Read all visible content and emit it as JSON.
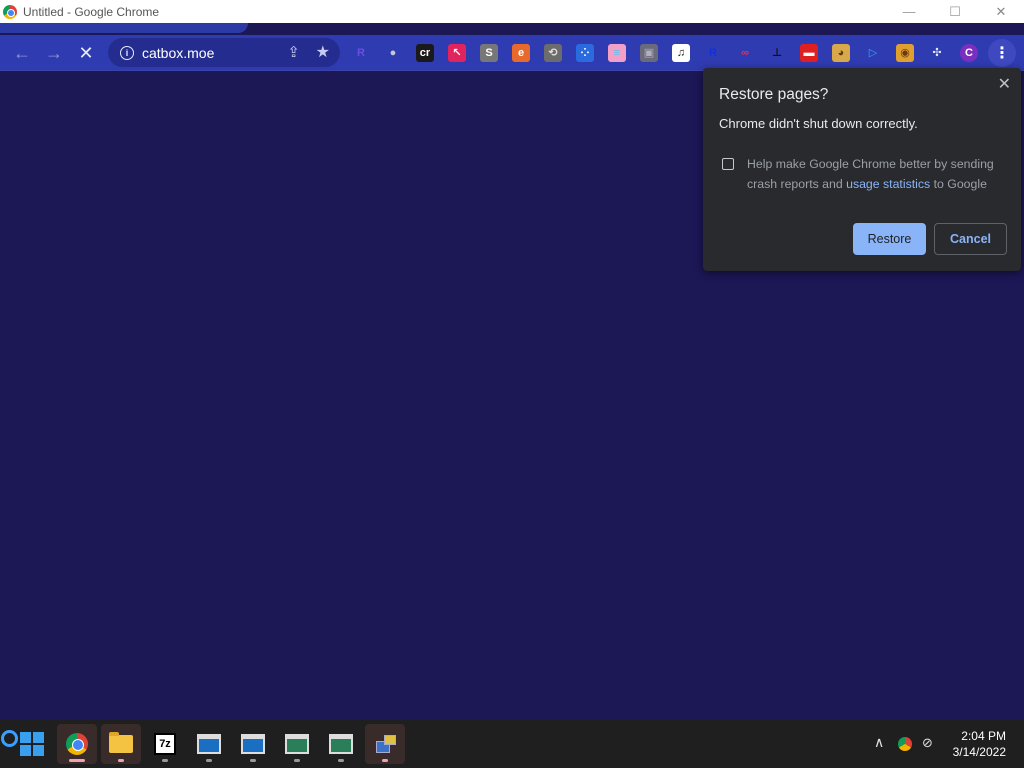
{
  "window": {
    "title": "Untitled - Google Chrome",
    "minimize": "—",
    "maximize": "☐",
    "close": "✕"
  },
  "toolbar": {
    "back_icon": "←",
    "forward_icon": "→",
    "stop_icon": "✕",
    "url": "catbox.moe",
    "share_icon": "⇪",
    "star_icon": "★",
    "menu_icon": "⋮"
  },
  "extensions": [
    {
      "name": "ext-r-icon",
      "glyph": "R",
      "bg": "transparent",
      "color": "#6b4fe0"
    },
    {
      "name": "ext-cloud-icon",
      "glyph": "●",
      "bg": "transparent",
      "color": "#c8c8d0"
    },
    {
      "name": "ext-cr-icon",
      "glyph": "cr",
      "bg": "#1a1a1a",
      "color": "#ffffff"
    },
    {
      "name": "ext-pointer-icon",
      "glyph": "↖",
      "bg": "#e0245e",
      "color": "#ffffff"
    },
    {
      "name": "ext-s-icon",
      "glyph": "S",
      "bg": "#777777",
      "color": "#ffffff"
    },
    {
      "name": "ext-edge-icon",
      "glyph": "e",
      "bg": "#e8692c",
      "color": "#ffffff"
    },
    {
      "name": "ext-sync-icon",
      "glyph": "⟲",
      "bg": "#6c6c6c",
      "color": "#e0e0e0"
    },
    {
      "name": "ext-grid-icon",
      "glyph": "⁘",
      "bg": "#2a6be0",
      "color": "#ffffff"
    },
    {
      "name": "ext-flag-icon",
      "glyph": "≡",
      "bg": "#f2a0c8",
      "color": "#5bc0f0"
    },
    {
      "name": "ext-image-icon",
      "glyph": "▣",
      "bg": "#6a6a7a",
      "color": "#b0b0c0"
    },
    {
      "name": "ext-clef-icon",
      "glyph": "♫",
      "bg": "#ffffff",
      "color": "#222222"
    },
    {
      "name": "ext-r-blue-icon",
      "glyph": "R",
      "bg": "transparent",
      "color": "#1030e0"
    },
    {
      "name": "ext-glasses-icon",
      "glyph": "∞",
      "bg": "transparent",
      "color": "#e03050"
    },
    {
      "name": "ext-stamp-icon",
      "glyph": "⊥",
      "bg": "transparent",
      "color": "#111111"
    },
    {
      "name": "ext-video-icon",
      "glyph": "▬",
      "bg": "#e02020",
      "color": "#ffffff"
    },
    {
      "name": "ext-doge-icon",
      "glyph": "◕",
      "bg": "#d9a84a",
      "color": "#5a3a10"
    },
    {
      "name": "ext-play-icon",
      "glyph": "▷",
      "bg": "transparent",
      "color": "#3aa0ff"
    },
    {
      "name": "ext-monkey-icon",
      "glyph": "◉",
      "bg": "#e0a030",
      "color": "#6a3a10"
    },
    {
      "name": "extensions-puzzle-icon",
      "glyph": "✣",
      "bg": "transparent",
      "color": "#e8eaff"
    },
    {
      "name": "profile-avatar-icon",
      "glyph": "C",
      "bg": "#7b2fbe",
      "color": "#ffffff"
    }
  ],
  "restore_bubble": {
    "title": "Restore pages?",
    "message": "Chrome didn't shut down correctly.",
    "consent_prefix": "Help make Google Chrome better by sending crash reports and ",
    "consent_link": "usage statistics",
    "consent_suffix": " to Google",
    "restore_label": "Restore",
    "cancel_label": "Cancel",
    "close_icon": "✕"
  },
  "taskbar": {
    "sevenzip_label": "7z",
    "tray_chevron": "∧",
    "tray_net": "⊘",
    "time": "2:04 PM",
    "date": "3/14/2022"
  },
  "colors": {
    "page_bg": "#1c1755",
    "toolbar_bg": "#2f3bb0",
    "bubble_bg": "#292a2d",
    "accent": "#8ab4f8",
    "taskbar_bg": "#1f1f1f"
  }
}
